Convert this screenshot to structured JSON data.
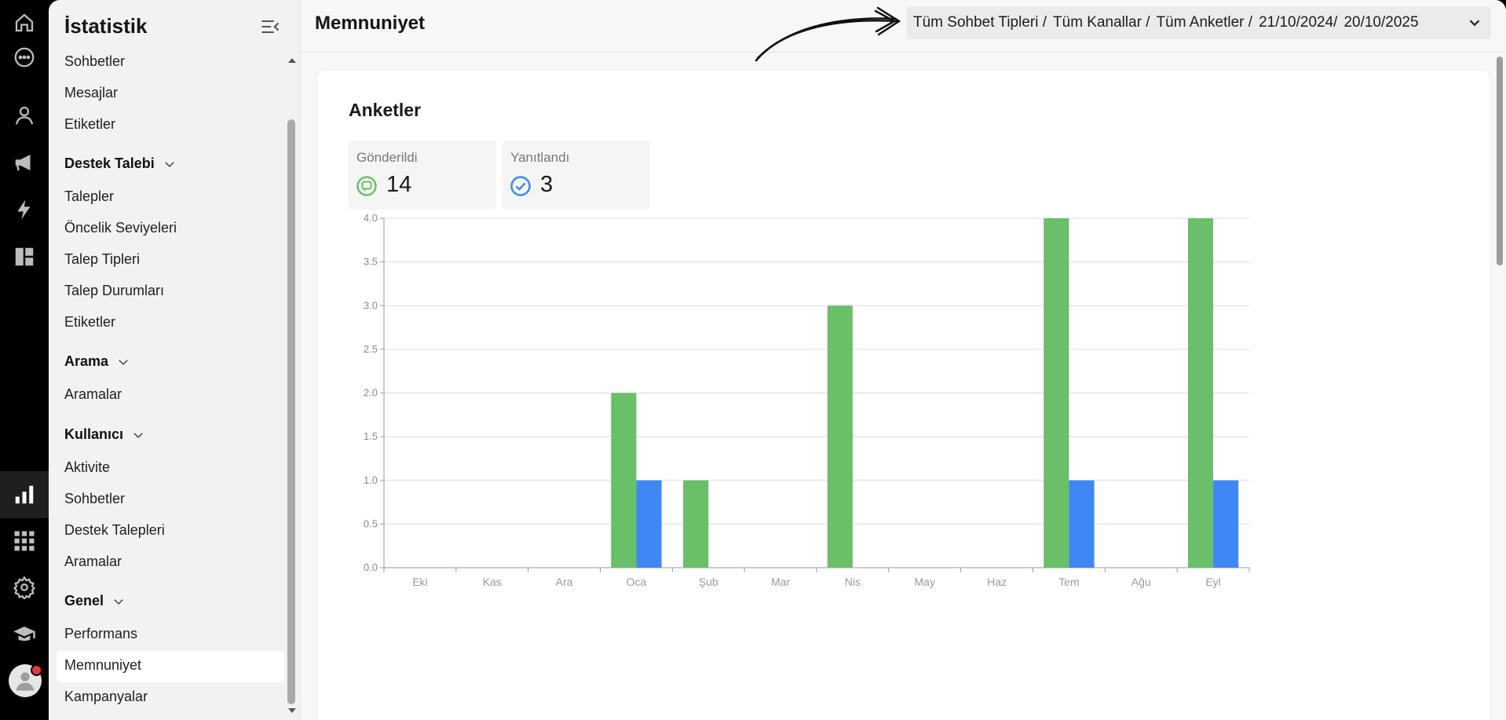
{
  "rail": {
    "icons": [
      "home-icon",
      "chat-bubble-icon",
      "user-icon",
      "megaphone-icon",
      "lightning-icon",
      "dashboard-icon",
      "bar-chart-icon",
      "apps-grid-icon",
      "gear-icon",
      "graduation-cap-icon"
    ],
    "active_icon": "bar-chart-icon"
  },
  "sidebar": {
    "title": "İstatistik",
    "items_top": [
      "Sohbetler",
      "Mesajlar",
      "Etiketler"
    ],
    "destek_label": "Destek Talebi",
    "destek_items": [
      "Talepler",
      "Öncelik Seviyeleri",
      "Talep Tipleri",
      "Talep Durumları",
      "Etiketler"
    ],
    "arama_label": "Arama",
    "arama_items": [
      "Aramalar"
    ],
    "kullanici_label": "Kullanıcı",
    "kullanici_items": [
      "Aktivite",
      "Sohbetler",
      "Destek Talepleri",
      "Aramalar"
    ],
    "genel_label": "Genel",
    "genel_items": [
      "Performans",
      "Memnuniyet",
      "Kampanyalar"
    ],
    "active_item": "Memnuniyet"
  },
  "header": {
    "title": "Memnuniyet",
    "filters": [
      "Tüm Sohbet Tipleri /",
      "Tüm Kanallar /",
      "Tüm Anketler /",
      "21/10/2024/",
      "20/10/2025"
    ]
  },
  "card": {
    "title": "Anketler",
    "sent_label": "Gönderildi",
    "sent_value": "14",
    "answered_label": "Yanıtlandı",
    "answered_value": "3"
  },
  "colors": {
    "sent": "#6abf69",
    "answered": "#3f87f5",
    "active_bg": "#ffffff"
  },
  "chart_data": {
    "type": "bar",
    "categories": [
      "Eki",
      "Kas",
      "Ara",
      "Oca",
      "Şub",
      "Mar",
      "Nis",
      "May",
      "Haz",
      "Tem",
      "Ağu",
      "Eyl"
    ],
    "series": [
      {
        "values": [
          0,
          0,
          0,
          2,
          1,
          0,
          3,
          0,
          0,
          4,
          0,
          4
        ]
      },
      {
        "values": [
          0,
          0,
          0,
          1,
          0,
          0,
          0,
          0,
          0,
          1,
          0,
          1
        ]
      }
    ],
    "yticks": [
      "0.0",
      "0.5",
      "1.0",
      "1.5",
      "2.0",
      "2.5",
      "3.0",
      "3.5",
      "4.0"
    ],
    "ylim": [
      0,
      4
    ],
    "grid": true
  }
}
